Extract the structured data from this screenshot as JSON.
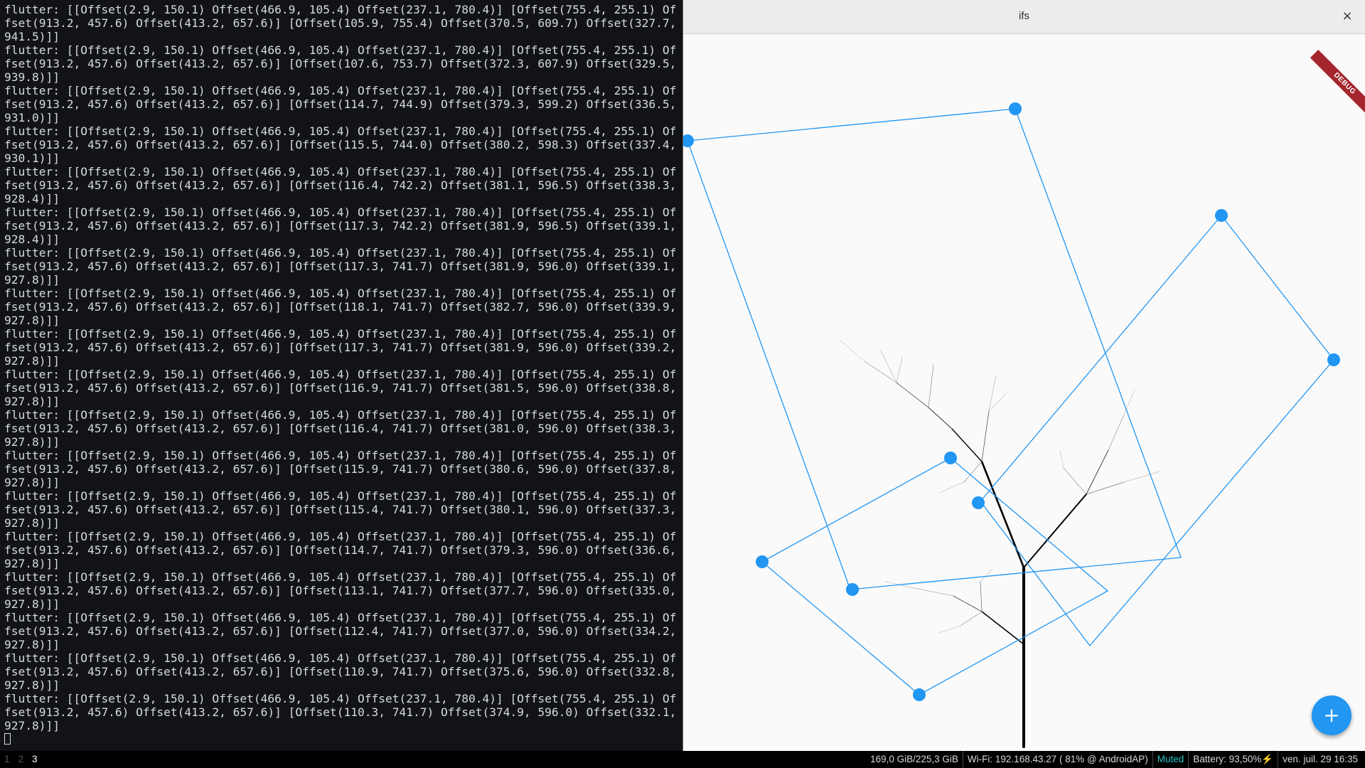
{
  "terminal": {
    "lines": [
      "flutter: [[Offset(2.9, 150.1) Offset(466.9, 105.4) Offset(237.1, 780.4)] [Offset(755.4, 255.1) Offset(913.2, 457.6) Offset(413.2, 657.6)] [Offset(105.9, 755.4) Offset(370.5, 609.7) Offset(327.7, 941.5)]]",
      "flutter: [[Offset(2.9, 150.1) Offset(466.9, 105.4) Offset(237.1, 780.4)] [Offset(755.4, 255.1) Offset(913.2, 457.6) Offset(413.2, 657.6)] [Offset(107.6, 753.7) Offset(372.3, 607.9) Offset(329.5, 939.8)]]",
      "flutter: [[Offset(2.9, 150.1) Offset(466.9, 105.4) Offset(237.1, 780.4)] [Offset(755.4, 255.1) Offset(913.2, 457.6) Offset(413.2, 657.6)] [Offset(114.7, 744.9) Offset(379.3, 599.2) Offset(336.5, 931.0)]]",
      "flutter: [[Offset(2.9, 150.1) Offset(466.9, 105.4) Offset(237.1, 780.4)] [Offset(755.4, 255.1) Offset(913.2, 457.6) Offset(413.2, 657.6)] [Offset(115.5, 744.0) Offset(380.2, 598.3) Offset(337.4, 930.1)]]",
      "flutter: [[Offset(2.9, 150.1) Offset(466.9, 105.4) Offset(237.1, 780.4)] [Offset(755.4, 255.1) Offset(913.2, 457.6) Offset(413.2, 657.6)] [Offset(116.4, 742.2) Offset(381.1, 596.5) Offset(338.3, 928.4)]]",
      "flutter: [[Offset(2.9, 150.1) Offset(466.9, 105.4) Offset(237.1, 780.4)] [Offset(755.4, 255.1) Offset(913.2, 457.6) Offset(413.2, 657.6)] [Offset(117.3, 742.2) Offset(381.9, 596.5) Offset(339.1, 928.4)]]",
      "flutter: [[Offset(2.9, 150.1) Offset(466.9, 105.4) Offset(237.1, 780.4)] [Offset(755.4, 255.1) Offset(913.2, 457.6) Offset(413.2, 657.6)] [Offset(117.3, 741.7) Offset(381.9, 596.0) Offset(339.1, 927.8)]]",
      "flutter: [[Offset(2.9, 150.1) Offset(466.9, 105.4) Offset(237.1, 780.4)] [Offset(755.4, 255.1) Offset(913.2, 457.6) Offset(413.2, 657.6)] [Offset(118.1, 741.7) Offset(382.7, 596.0) Offset(339.9, 927.8)]]",
      "flutter: [[Offset(2.9, 150.1) Offset(466.9, 105.4) Offset(237.1, 780.4)] [Offset(755.4, 255.1) Offset(913.2, 457.6) Offset(413.2, 657.6)] [Offset(117.3, 741.7) Offset(381.9, 596.0) Offset(339.2, 927.8)]]",
      "flutter: [[Offset(2.9, 150.1) Offset(466.9, 105.4) Offset(237.1, 780.4)] [Offset(755.4, 255.1) Offset(913.2, 457.6) Offset(413.2, 657.6)] [Offset(116.9, 741.7) Offset(381.5, 596.0) Offset(338.8, 927.8)]]",
      "flutter: [[Offset(2.9, 150.1) Offset(466.9, 105.4) Offset(237.1, 780.4)] [Offset(755.4, 255.1) Offset(913.2, 457.6) Offset(413.2, 657.6)] [Offset(116.4, 741.7) Offset(381.0, 596.0) Offset(338.3, 927.8)]]",
      "flutter: [[Offset(2.9, 150.1) Offset(466.9, 105.4) Offset(237.1, 780.4)] [Offset(755.4, 255.1) Offset(913.2, 457.6) Offset(413.2, 657.6)] [Offset(115.9, 741.7) Offset(380.6, 596.0) Offset(337.8, 927.8)]]",
      "flutter: [[Offset(2.9, 150.1) Offset(466.9, 105.4) Offset(237.1, 780.4)] [Offset(755.4, 255.1) Offset(913.2, 457.6) Offset(413.2, 657.6)] [Offset(115.4, 741.7) Offset(380.1, 596.0) Offset(337.3, 927.8)]]",
      "flutter: [[Offset(2.9, 150.1) Offset(466.9, 105.4) Offset(237.1, 780.4)] [Offset(755.4, 255.1) Offset(913.2, 457.6) Offset(413.2, 657.6)] [Offset(114.7, 741.7) Offset(379.3, 596.0) Offset(336.6, 927.8)]]",
      "flutter: [[Offset(2.9, 150.1) Offset(466.9, 105.4) Offset(237.1, 780.4)] [Offset(755.4, 255.1) Offset(913.2, 457.6) Offset(413.2, 657.6)] [Offset(113.1, 741.7) Offset(377.7, 596.0) Offset(335.0, 927.8)]]",
      "flutter: [[Offset(2.9, 150.1) Offset(466.9, 105.4) Offset(237.1, 780.4)] [Offset(755.4, 255.1) Offset(913.2, 457.6) Offset(413.2, 657.6)] [Offset(112.4, 741.7) Offset(377.0, 596.0) Offset(334.2, 927.8)]]",
      "flutter: [[Offset(2.9, 150.1) Offset(466.9, 105.4) Offset(237.1, 780.4)] [Offset(755.4, 255.1) Offset(913.2, 457.6) Offset(413.2, 657.6)] [Offset(110.9, 741.7) Offset(375.6, 596.0) Offset(332.8, 927.8)]]",
      "flutter: [[Offset(2.9, 150.1) Offset(466.9, 105.4) Offset(237.1, 780.4)] [Offset(755.4, 255.1) Offset(913.2, 457.6) Offset(413.2, 657.6)] [Offset(110.3, 741.7) Offset(374.9, 596.0) Offset(332.1, 927.8)]]"
    ]
  },
  "app": {
    "title": "ifs",
    "close_glyph": "×",
    "debug_label": "DEBUG",
    "fab_glyph": "+",
    "accent_color": "#2196f3"
  },
  "statusbar": {
    "workspaces": [
      "1",
      "2",
      "3"
    ],
    "active_workspace": "3",
    "disk": "169,0 GiB/225,3 GiB",
    "wifi": "Wi-Fi: 192.168.43.27 ( 81% @ AndroidAP)",
    "audio": "Muted",
    "battery": "Battery: 93,50%⚡",
    "datetime": "ven. juil. 29  16:35"
  }
}
